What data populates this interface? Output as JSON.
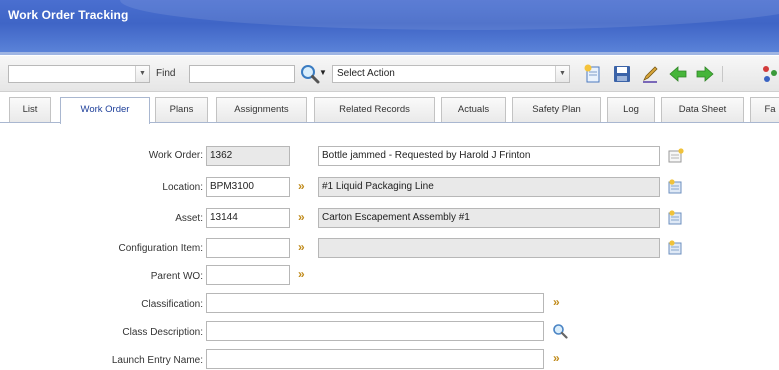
{
  "app": {
    "title": "Work Order Tracking"
  },
  "toolbar": {
    "find_label": "Find",
    "find_value": "",
    "left_select_value": "",
    "action_select": "Select Action"
  },
  "tabs": [
    {
      "label": "List",
      "active": false
    },
    {
      "label": "Work Order",
      "active": true
    },
    {
      "label": "Plans",
      "active": false
    },
    {
      "label": "Assignments",
      "active": false
    },
    {
      "label": "Related Records",
      "active": false
    },
    {
      "label": "Actuals",
      "active": false
    },
    {
      "label": "Safety Plan",
      "active": false
    },
    {
      "label": "Log",
      "active": false
    },
    {
      "label": "Data Sheet",
      "active": false
    },
    {
      "label": "Fa",
      "active": false
    }
  ],
  "form": {
    "work_order": {
      "label": "Work Order:",
      "value": "1362",
      "description": "Bottle jammed - Requested by Harold J Frinton"
    },
    "location": {
      "label": "Location:",
      "value": "BPM3100",
      "description": "#1 Liquid Packaging Line"
    },
    "asset": {
      "label": "Asset:",
      "value": "13144",
      "description": "Carton Escapement Assembly #1"
    },
    "configuration_item": {
      "label": "Configuration Item:",
      "value": "",
      "description": ""
    },
    "parent_wo": {
      "label": "Parent WO:",
      "value": ""
    },
    "classification": {
      "label": "Classification:",
      "value": ""
    },
    "class_description": {
      "label": "Class Description:",
      "value": ""
    },
    "launch_entry_name": {
      "label": "Launch Entry Name:",
      "value": ""
    }
  },
  "colors": {
    "title_bar": "#3f65c6",
    "active_tab_text": "#1e3f9a",
    "chevron": "#c08b1c"
  }
}
